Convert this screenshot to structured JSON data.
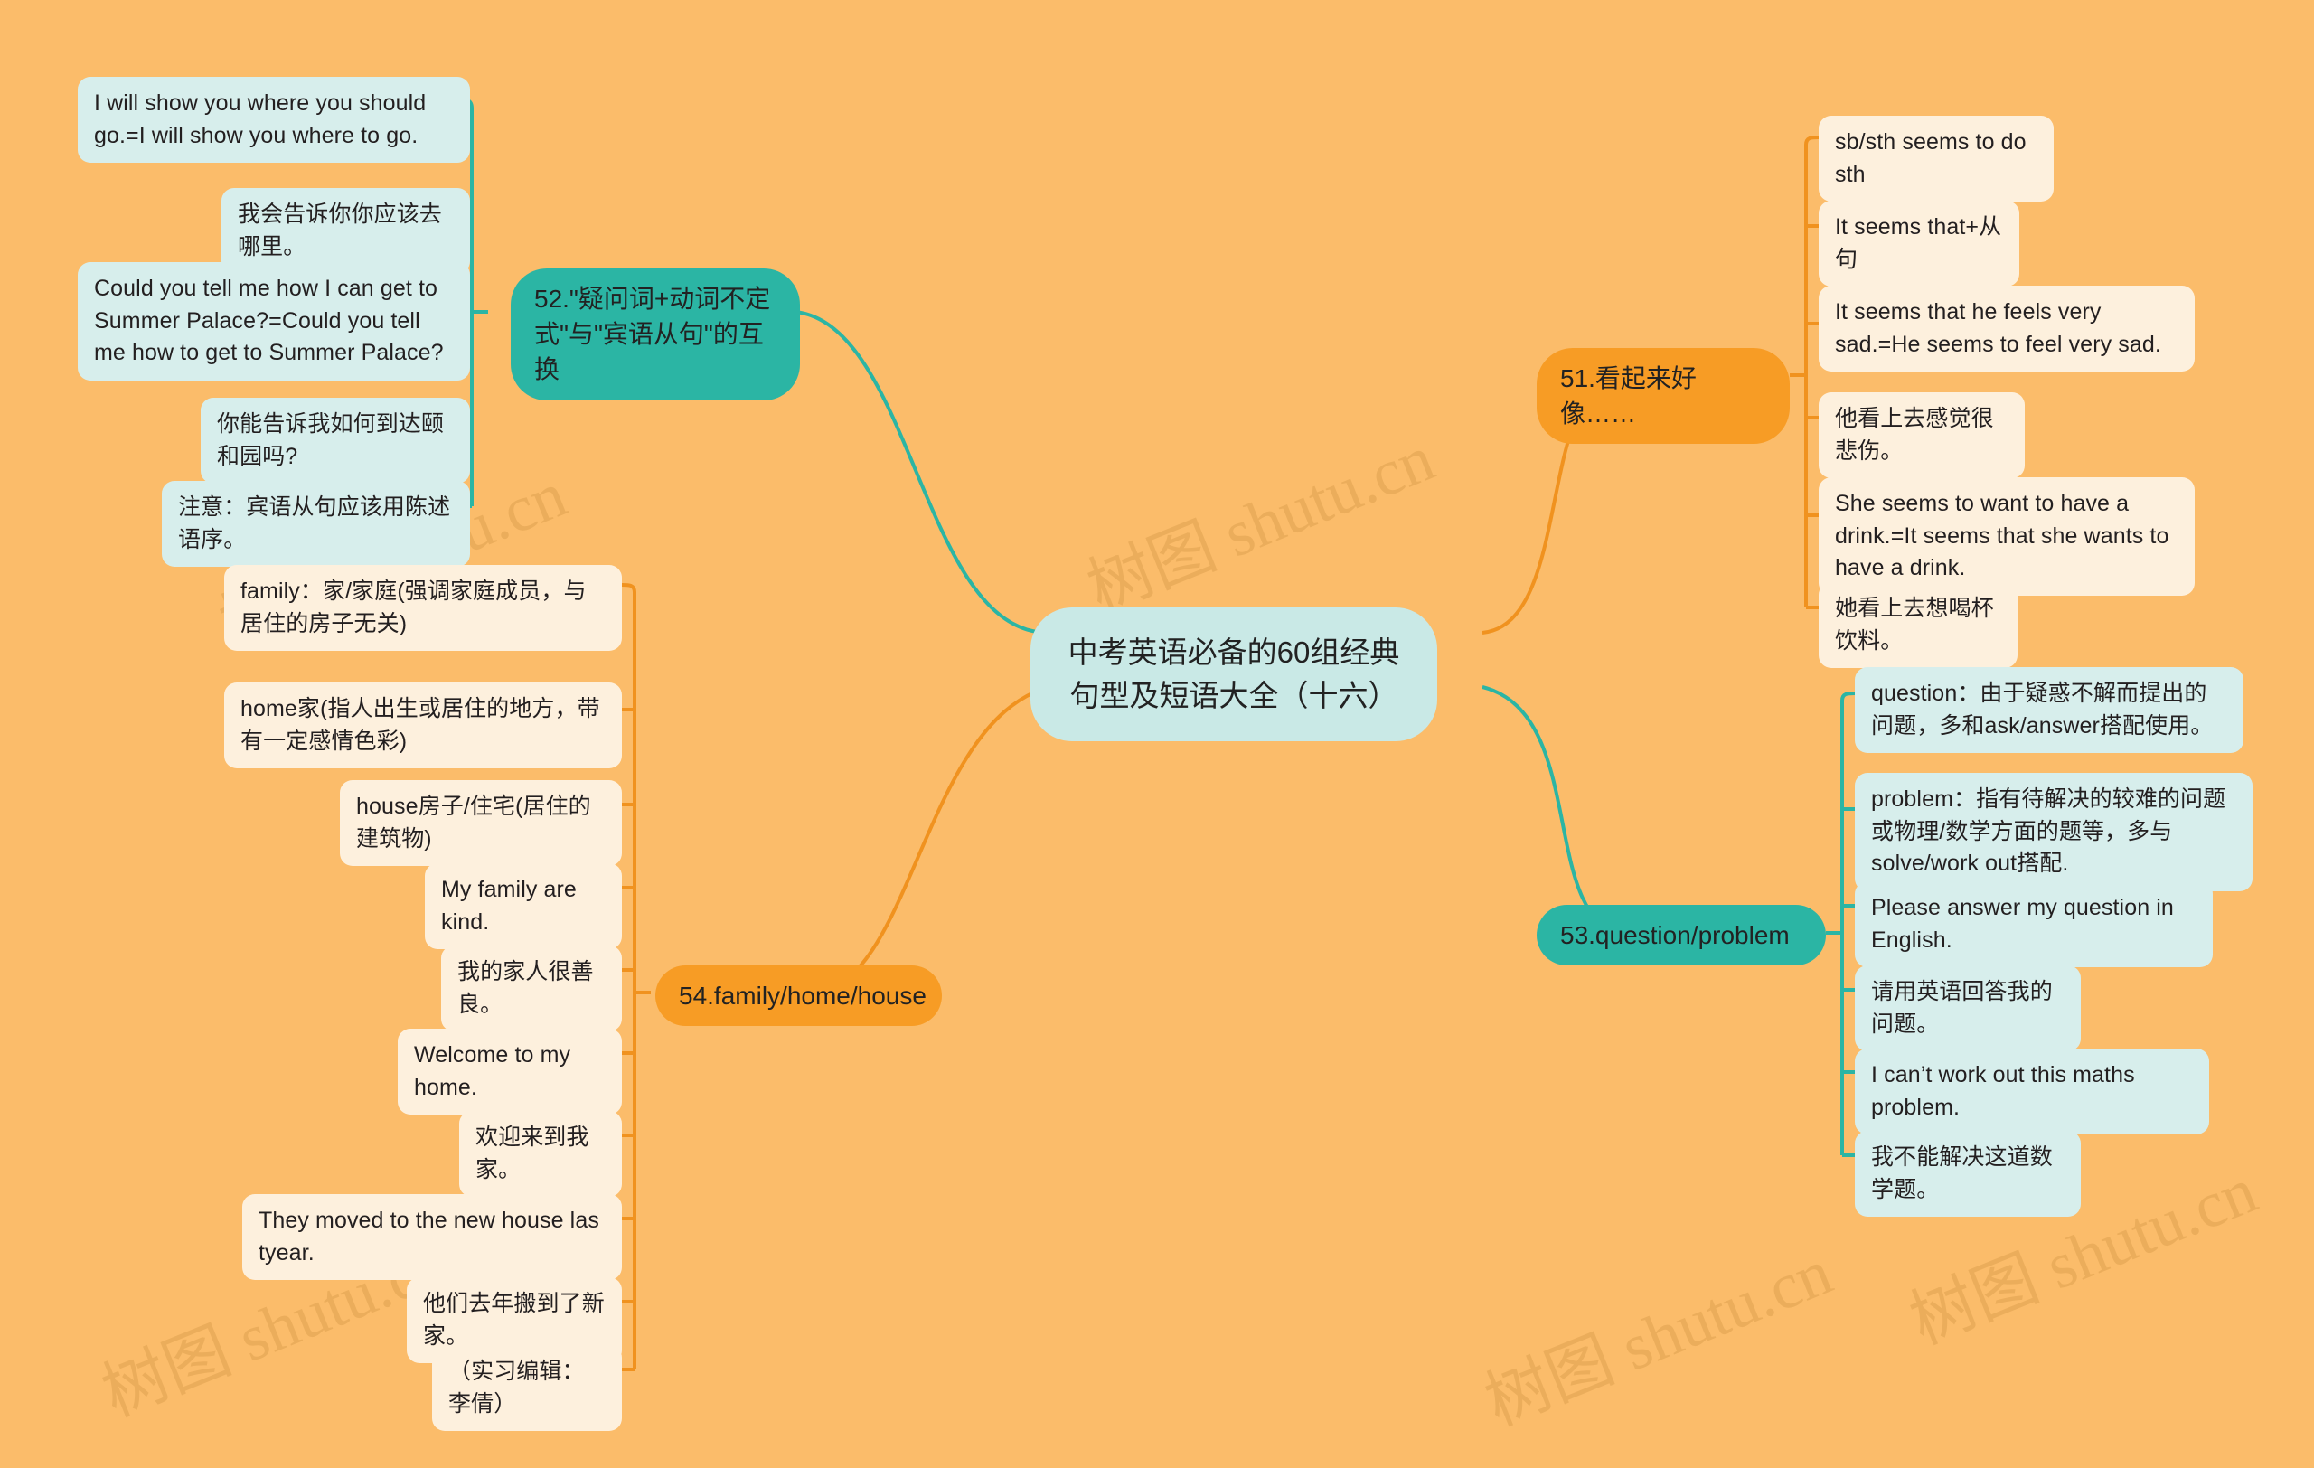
{
  "watermarks": [
    "树图 shutu.cn",
    "树图 shutu.cn",
    "树图 shutu.cn",
    "树图 shutu.cn",
    "树图 shutu.cn"
  ],
  "colors": {
    "background": "#fbbc6a",
    "root_fill": "#c9e9e6",
    "branch_teal": "#2bb5a4",
    "branch_orange": "#f79c25",
    "leaf_cyan": "#d7eeec",
    "leaf_cream": "#fdf0dd",
    "link_teal": "#2bb5a4",
    "link_orange": "#f0921f",
    "text": "#231f20"
  },
  "root": {
    "title": "中考英语必备的60组经典句型及短语大全（十六）"
  },
  "branches": [
    {
      "id": "b51",
      "label": "51.看起来好像……",
      "style": "orange",
      "side": "right",
      "children": [
        {
          "text": "sb/sth seems to do sth",
          "style": "cream"
        },
        {
          "text": "It seems that+从句",
          "style": "cream"
        },
        {
          "text": "It seems that he feels very sad.=He seems to feel very sad.",
          "style": "cream"
        },
        {
          "text": "他看上去感觉很悲伤。",
          "style": "cream"
        },
        {
          "text": "She seems to want to have a drink.=It seems that she wants to have a drink.",
          "style": "cream"
        },
        {
          "text": "她看上去想喝杯饮料。",
          "style": "cream"
        }
      ]
    },
    {
      "id": "b52",
      "label": "52.\"疑问词+动词不定式\"与\"宾语从句\"的互换",
      "style": "teal",
      "side": "left",
      "children": [
        {
          "text": "I will show you where you should go.=I will show you where to go.",
          "style": "cyan"
        },
        {
          "text": "我会告诉你你应该去哪里。",
          "style": "cyan"
        },
        {
          "text": "Could you tell me how I can get to Summer Palace?=Could you tell me how to get to Summer Palace?",
          "style": "cyan"
        },
        {
          "text": "你能告诉我如何到达颐和园吗?",
          "style": "cyan"
        },
        {
          "text": "注意：宾语从句应该用陈述语序。",
          "style": "cyan"
        }
      ]
    },
    {
      "id": "b53",
      "label": "53.question/problem",
      "style": "teal",
      "side": "right",
      "children": [
        {
          "text": "question：由于疑惑不解而提出的问题，多和ask/answer搭配使用。",
          "style": "cyan"
        },
        {
          "text": "problem：指有待解决的较难的问题或物理/数学方面的题等，多与solve/work out搭配.",
          "style": "cyan"
        },
        {
          "text": "Please answer my question in English.",
          "style": "cyan"
        },
        {
          "text": "请用英语回答我的问题。",
          "style": "cyan"
        },
        {
          "text": "I can’t work out this maths problem.",
          "style": "cyan"
        },
        {
          "text": "我不能解决这道数学题。",
          "style": "cyan"
        }
      ]
    },
    {
      "id": "b54",
      "label": "54.family/home/house",
      "style": "orange",
      "side": "left",
      "children": [
        {
          "text": "family：家/家庭(强调家庭成员，与居住的房子无关)",
          "style": "cream"
        },
        {
          "text": "home家(指人出生或居住的地方，带有一定感情色彩)",
          "style": "cream"
        },
        {
          "text": "house房子/住宅(居住的建筑物)",
          "style": "cream"
        },
        {
          "text": "My family are kind.",
          "style": "cream"
        },
        {
          "text": "我的家人很善良。",
          "style": "cream"
        },
        {
          "text": "Welcome to my home.",
          "style": "cream"
        },
        {
          "text": "欢迎来到我家。",
          "style": "cream"
        },
        {
          "text": "They moved to the new house las tyear.",
          "style": "cream"
        },
        {
          "text": "他们去年搬到了新家。",
          "style": "cream"
        },
        {
          "text": "（实习编辑：李倩）",
          "style": "cream"
        }
      ]
    }
  ]
}
